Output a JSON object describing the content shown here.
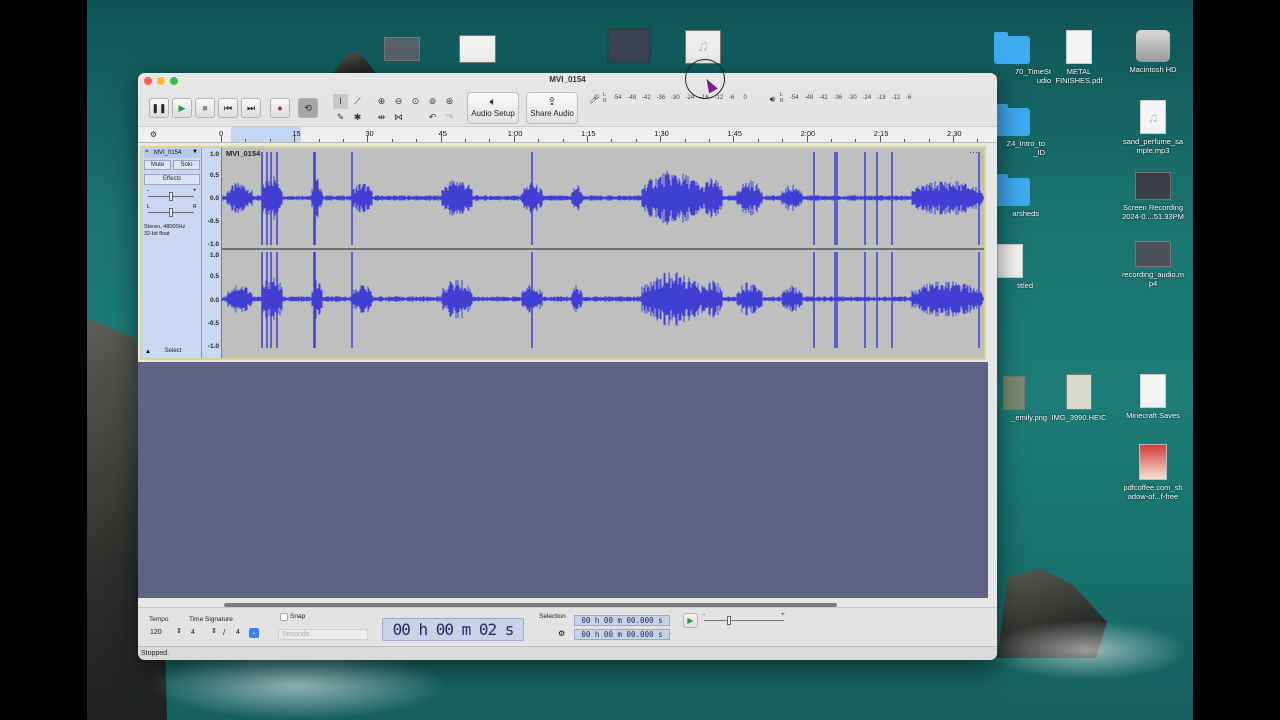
{
  "desktop": {
    "icons": [
      {
        "label": "70_TimeSt\nudio",
        "kind": "folder"
      },
      {
        "label": "METAL\nFINISHES.pdf",
        "kind": "doc"
      },
      {
        "label": "Macintosh HD",
        "kind": "drive"
      },
      {
        "label": "sand_perfume_sa\nmple.mp3",
        "kind": "audio"
      },
      {
        "label": "Z4_Intro_to\n_ID",
        "kind": "folder"
      },
      {
        "label": "Screen Recording\n2024-0....51.33PM",
        "kind": "video"
      },
      {
        "label": "arsheds",
        "kind": "folder"
      },
      {
        "label": "recording_audio.m\np4",
        "kind": "video"
      },
      {
        "label": "titled",
        "kind": "doc"
      },
      {
        "label": "_emily.png",
        "kind": "image"
      },
      {
        "label": "IMG_3990.HEIC",
        "kind": "image"
      },
      {
        "label": "Minecraft Saves",
        "kind": "doc"
      },
      {
        "label": "pdfcoffee.com_sh\nadow-of...f-free",
        "kind": "pdf"
      }
    ]
  },
  "window": {
    "title": "MVI_0154"
  },
  "toolbar": {
    "audio_setup_label": "Audio Setup",
    "share_audio_label": "Share Audio",
    "record_meter_ticks": [
      "-54",
      "-48",
      "-42",
      "-36",
      "-30",
      "-24",
      "-18",
      "-12",
      "-6",
      "0"
    ],
    "play_meter_ticks": [
      "-54",
      "-48",
      "-42",
      "-36",
      "-30",
      "-24",
      "-18",
      "-12",
      "-6"
    ],
    "meter_lr": [
      "L",
      "R"
    ]
  },
  "ruler": {
    "labels": [
      "0",
      "15",
      "30",
      "45",
      "1:00",
      "1:15",
      "1:30",
      "1:45",
      "2:00",
      "2:15",
      "2:30"
    ]
  },
  "track": {
    "name": "MVI_0154",
    "clip_name": "MVI_0154",
    "mute_label": "Mute",
    "solo_label": "Solo",
    "effects_label": "Effects",
    "info_line1": "Stereo, 48000Hz",
    "info_line2": "32-bit float",
    "select_label": "Select",
    "gain_minus": "-",
    "gain_plus": "+",
    "pan_l": "L",
    "pan_r": "R",
    "scale_labels": [
      "1.0",
      "0.5",
      "0.0",
      "-0.5",
      "-1.0",
      "1.0",
      "0.5",
      "0.0",
      "-0.5",
      "-1.0"
    ],
    "waveform_color": "#3f3fd4"
  },
  "bottom": {
    "tempo_label": "Tempo",
    "tempo_value": "120",
    "time_sig_label": "Time Signature",
    "time_sig_num": "4",
    "time_sig_sep": "/",
    "time_sig_den": "4",
    "snap_label": "Snap",
    "snap_unit": "Seconds",
    "time_display": "00 h 00 m 02 s",
    "selection_label": "Selection",
    "selection_start": "00 h 00 m 00.000 s",
    "selection_end": "00 h 00 m 00.000 s",
    "speed_minus": "-",
    "speed_plus": "+"
  },
  "status": {
    "text": "Stopped."
  }
}
